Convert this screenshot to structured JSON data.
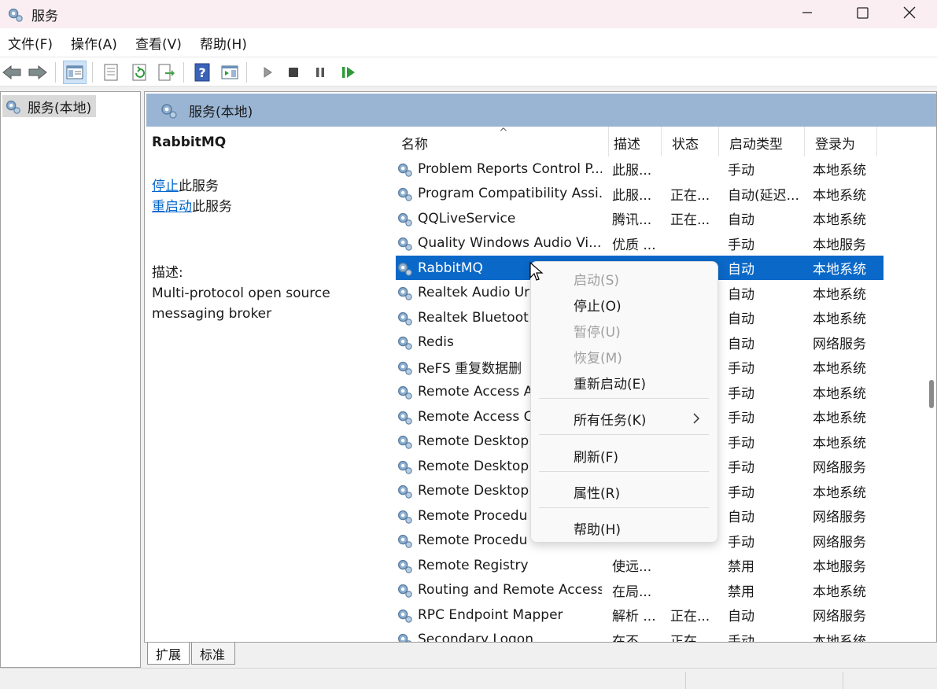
{
  "window": {
    "title": "服务"
  },
  "menubar": [
    "文件(F)",
    "操作(A)",
    "查看(V)",
    "帮助(H)"
  ],
  "toolbar_icons": [
    "back-icon",
    "forward-icon",
    "show-hide-tree-icon",
    "properties-icon",
    "refresh-icon",
    "export-list-icon",
    "help-icon",
    "action-pane-icon",
    "start-service-icon",
    "stop-service-icon",
    "pause-service-icon",
    "resume-service-icon"
  ],
  "tree": {
    "root": "服务(本地)"
  },
  "panel": {
    "header": "服务(本地)",
    "selected_service": "RabbitMQ",
    "stop_link": "停止",
    "stop_suffix": "此服务",
    "restart_link": "重启动",
    "restart_suffix": "此服务",
    "desc_label": "描述:",
    "desc_line1": "Multi-protocol open source",
    "desc_line2": "messaging broker"
  },
  "columns": [
    "名称",
    "描述",
    "状态",
    "启动类型",
    "登录为"
  ],
  "rows": [
    {
      "name": "Problem Reports Control P...",
      "desc": "此服...",
      "status": "",
      "startup": "手动",
      "logon": "本地系统"
    },
    {
      "name": "Program Compatibility Assi...",
      "desc": "此服...",
      "status": "正在...",
      "startup": "自动(延迟...",
      "logon": "本地系统"
    },
    {
      "name": "QQLiveService",
      "desc": "腾讯...",
      "status": "正在...",
      "startup": "自动",
      "logon": "本地系统"
    },
    {
      "name": "Quality Windows Audio Vi...",
      "desc": "优质 ...",
      "status": "",
      "startup": "手动",
      "logon": "本地服务"
    },
    {
      "name": "RabbitMQ",
      "desc": "",
      "status": "",
      "startup": "自动",
      "logon": "本地系统"
    },
    {
      "name": "Realtek Audio Ur",
      "desc": "",
      "status": "",
      "startup": "自动",
      "logon": "本地系统"
    },
    {
      "name": "Realtek Bluetoot",
      "desc": "",
      "status": "",
      "startup": "自动",
      "logon": "本地系统"
    },
    {
      "name": "Redis",
      "desc": "",
      "status": "",
      "startup": "自动",
      "logon": "网络服务"
    },
    {
      "name": "ReFS 重复数据删",
      "desc": "",
      "status": "",
      "startup": "手动",
      "logon": "本地系统"
    },
    {
      "name": "Remote Access A",
      "desc": "",
      "status": "",
      "startup": "手动",
      "logon": "本地系统"
    },
    {
      "name": "Remote Access C",
      "desc": "",
      "status": "",
      "startup": "手动",
      "logon": "本地系统"
    },
    {
      "name": "Remote Desktop",
      "desc": "",
      "status": "",
      "startup": "手动",
      "logon": "本地系统"
    },
    {
      "name": "Remote Desktop",
      "desc": "",
      "status": "",
      "startup": "手动",
      "logon": "网络服务"
    },
    {
      "name": "Remote Desktop",
      "desc": "",
      "status": "",
      "startup": "手动",
      "logon": "本地系统"
    },
    {
      "name": "Remote Procedu",
      "desc": "",
      "status": "",
      "startup": "自动",
      "logon": "网络服务"
    },
    {
      "name": "Remote Procedu",
      "desc": "",
      "status": "",
      "startup": "手动",
      "logon": "网络服务"
    },
    {
      "name": "Remote Registry",
      "desc": "使远...",
      "status": "",
      "startup": "禁用",
      "logon": "本地服务"
    },
    {
      "name": "Routing and Remote Access",
      "desc": "在局...",
      "status": "",
      "startup": "禁用",
      "logon": "本地系统"
    },
    {
      "name": "RPC Endpoint Mapper",
      "desc": "解析 ...",
      "status": "正在...",
      "startup": "自动",
      "logon": "网络服务"
    },
    {
      "name": "Secondary Logon",
      "desc": "在不...",
      "status": "正在...",
      "startup": "手动",
      "logon": "本地系统"
    }
  ],
  "context_menu": {
    "start": "启动(S)",
    "stop": "停止(O)",
    "pause": "暂停(U)",
    "resume": "恢复(M)",
    "restart": "重新启动(E)",
    "all_tasks": "所有任务(K)",
    "refresh": "刷新(F)",
    "properties": "属性(R)",
    "help": "帮助(H)"
  },
  "tabs": [
    "扩展",
    "标准"
  ],
  "colors": {
    "selection": "#0a68c8",
    "panel_header": "#9ab5d4",
    "link": "#0066cc"
  }
}
